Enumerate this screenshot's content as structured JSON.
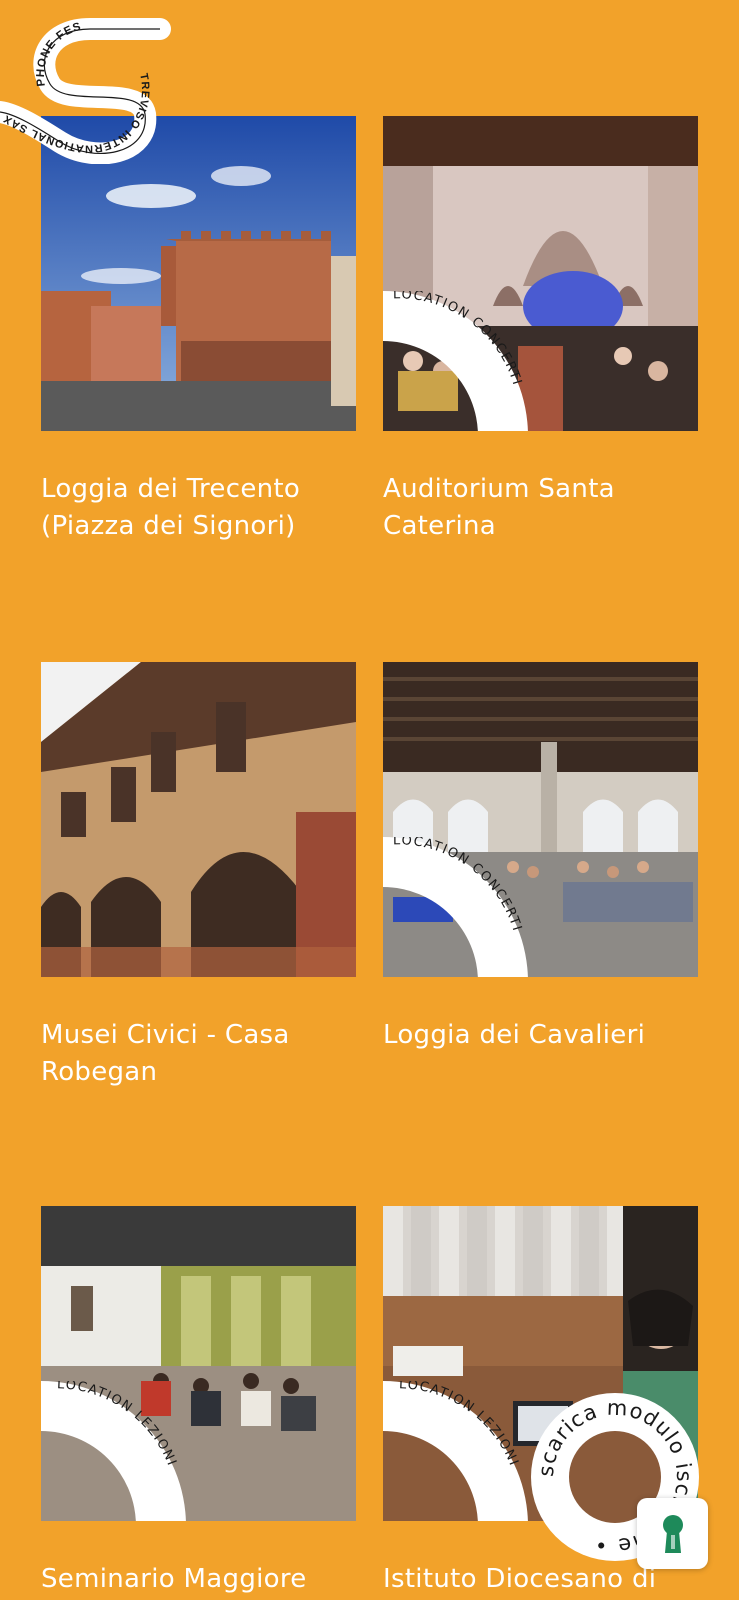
{
  "logo": {
    "line1": "PHONE FESTIVAL",
    "line2": "TREVISO INTERNATIONAL SAXO"
  },
  "locations": [
    {
      "title": "Loggia dei Trecento (Piazza dei Signori)",
      "badge": ""
    },
    {
      "title": "Auditorium Santa Caterina",
      "badge": "LOCATION CONCERTI"
    },
    {
      "title": "Musei Civici - Casa Robegan",
      "badge": ""
    },
    {
      "title": "Loggia dei Cavalieri",
      "badge": "LOCATION CONCERTI"
    },
    {
      "title": "Seminario Maggiore",
      "badge": "LOCATION LEZIONI"
    },
    {
      "title": "Istituto Diocesano di",
      "badge": "LOCATION LEZIONI"
    }
  ],
  "download_badge": "scarica modulo iscrizione •",
  "fab_icon": "keyhole-icon",
  "colors": {
    "background": "#F2A22A",
    "text": "#ffffff",
    "badge": "#ffffff"
  }
}
